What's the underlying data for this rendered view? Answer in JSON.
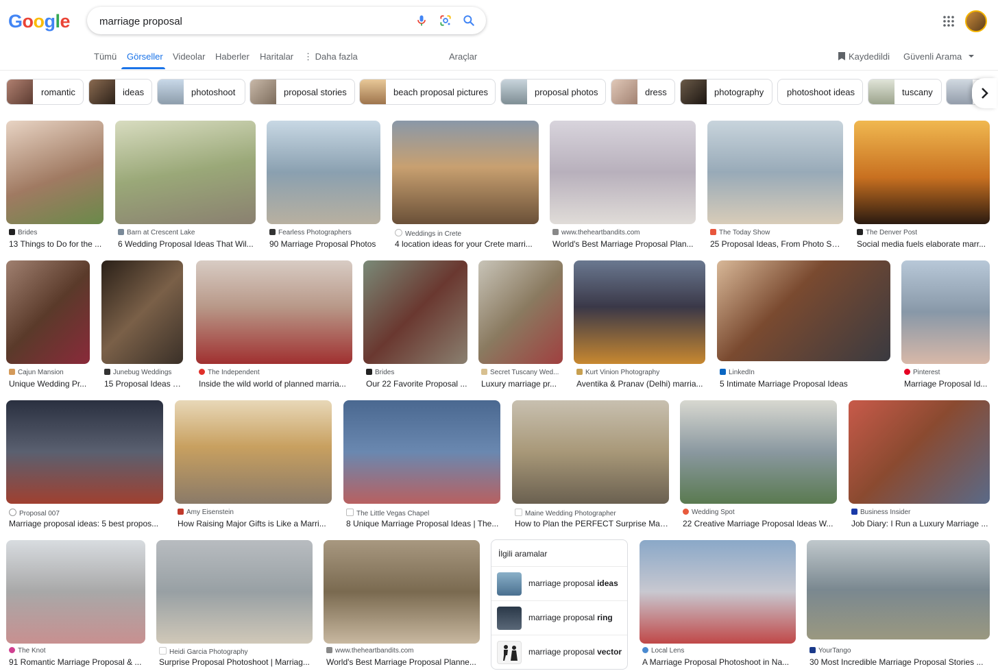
{
  "logo": [
    "G",
    "o",
    "o",
    "g",
    "l",
    "e"
  ],
  "logo_colors": [
    "#4285F4",
    "#EA4335",
    "#FBBC05",
    "#4285F4",
    "#34A853",
    "#EA4335"
  ],
  "search": {
    "value": "marriage proposal"
  },
  "icons": {
    "mic": "microphone-icon",
    "lens": "google-lens-icon",
    "search": "search-icon",
    "apps": "apps-grid-icon",
    "saved": "bookmark-icon",
    "next": "chevron-right-icon"
  },
  "tabs": [
    {
      "label": "Tümü",
      "active": false
    },
    {
      "label": "Görseller",
      "active": true
    },
    {
      "label": "Videolar",
      "active": false
    },
    {
      "label": "Haberler",
      "active": false
    },
    {
      "label": "Haritalar",
      "active": false
    },
    {
      "label": "Daha fazla",
      "active": false
    }
  ],
  "tools_label": "Araçlar",
  "saved_label": "Kaydedildi",
  "safesearch_label": "Güvenli Arama",
  "chips": [
    {
      "label": "romantic",
      "color": "#8a5a48"
    },
    {
      "label": "ideas",
      "color": "#4a3a30"
    },
    {
      "label": "photoshoot",
      "color": "#9bb2c8"
    },
    {
      "label": "proposal stories",
      "color": "#a89888"
    },
    {
      "label": "beach proposal pictures",
      "color": "#c9a070"
    },
    {
      "label": "proposal photos",
      "color": "#9fb0b8"
    },
    {
      "label": "dress",
      "color": "#c8a898"
    },
    {
      "label": "photography",
      "color": "#3a3028"
    },
    {
      "label": "photoshoot ideas",
      "color": ""
    },
    {
      "label": "tuscany",
      "color": "#b8c0a8"
    },
    {
      "label": "",
      "color": "#b0b8c8"
    }
  ],
  "results": [
    {
      "source": "Brides",
      "title": "13 Things to Do for the ...",
      "color": "#c9a896",
      "fav": "#222222"
    },
    {
      "source": "Barn at Crescent Lake",
      "title": "6 Wedding Proposal Ideas That Wil...",
      "color": "#a9b38f",
      "fav": "#7a8a99"
    },
    {
      "source": "Fearless Photographers",
      "title": "90 Marriage Proposal Photos",
      "color": "#8fa8b8",
      "fav": "#333333"
    },
    {
      "source": "Weddings in Crete",
      "title": "4 location ideas for your Crete marri...",
      "color": "#8a7a6a",
      "fav": "#cccccc"
    },
    {
      "source": "www.theheartbandits.com",
      "title": "World's Best Marriage Proposal Plan...",
      "color": "#c8c4cc",
      "fav": "#888888"
    },
    {
      "source": "The Today Show",
      "title": "25 Proposal Ideas, From Photo Sh...",
      "color": "#b8c8d4",
      "fav": "#e8563c"
    },
    {
      "source": "The Denver Post",
      "title": "Social media fuels elaborate marr...",
      "color": "#c88838",
      "fav": "#222222"
    },
    {
      "source": "Cajun Mansion",
      "title": "Unique Wedding Pr...",
      "color": "#6a5040",
      "fav": "#d49a5a"
    },
    {
      "source": "Junebug Weddings",
      "title": "15 Proposal Ideas T...",
      "color": "#3a3028",
      "fav": "#333333"
    },
    {
      "source": "The Independent",
      "title": "Inside the wild world of planned marria...",
      "color": "#b89888",
      "fav": "#e0302a"
    },
    {
      "source": "Brides",
      "title": "Our 22 Favorite Proposal ...",
      "color": "#8a8070",
      "fav": "#222222"
    },
    {
      "source": "Secret Tuscany Wed...",
      "title": "Luxury marriage pr...",
      "color": "#9a9080",
      "fav": "#d8c090"
    },
    {
      "source": "Kurt Vinion Photography",
      "title": "Aventika & Pranav (Delhi) marria...",
      "color": "#4a4a5a",
      "fav": "#c8a050"
    },
    {
      "source": "LinkedIn",
      "title": "5 Intimate Marriage Proposal Ideas",
      "color": "#c8a888",
      "fav": "#0a66c2"
    },
    {
      "source": "Pinterest",
      "title": "Marriage Proposal Id...",
      "color": "#a8b8c8",
      "fav": "#e60023"
    },
    {
      "source": "Proposal 007",
      "title": "Marriage proposal ideas: 5 best propos...",
      "color": "#3a3a48",
      "fav": "#999999"
    },
    {
      "source": "Amy Eisenstein",
      "title": "How Raising Major Gifts is Like a Marri...",
      "color": "#b89868",
      "fav": "#c0392b"
    },
    {
      "source": "The Little Vegas Chapel",
      "title": "8 Unique Marriage Proposal Ideas | The...",
      "color": "#5878a0",
      "fav": "#cccccc"
    },
    {
      "source": "Maine Wedding Photographer",
      "title": "How to Plan the PERFECT Surprise Mar...",
      "color": "#a89878",
      "fav": "#dddddd"
    },
    {
      "source": "Wedding Spot",
      "title": "22 Creative Marriage Proposal Ideas W...",
      "color": "#9aa8b0",
      "fav": "#e85a3c"
    },
    {
      "source": "Business Insider",
      "title": "Job Diary: I Run a Luxury Marriage ...",
      "color": "#a8684a",
      "fav": "#1a3aa8"
    },
    {
      "source": "The Knot",
      "title": "91 Romantic Marriage Proposal & ...",
      "color": "#b8b0a8",
      "fav": "#d04090"
    },
    {
      "source": "Heidi Garcia Photography",
      "title": "Surprise Proposal Photoshoot | Marriag...",
      "color": "#a8a8a4",
      "fav": "#cccccc"
    },
    {
      "source": "www.theheartbandits.com",
      "title": "World's Best Marriage Proposal Planne...",
      "color": "#8a7a60",
      "fav": "#888888"
    },
    {
      "source": "Local Lens",
      "title": "A Marriage Proposal Photoshoot in Na...",
      "color": "#7898b8",
      "fav": "#4a8ad0"
    },
    {
      "source": "YourTango",
      "title": "30 Most Incredible Marriage Proposal Stories ...",
      "color": "#8a9088",
      "fav": "#1a3a8a"
    }
  ],
  "related": {
    "heading": "İlgili aramalar",
    "items": [
      {
        "prefix": "marriage proposal ",
        "bold": "ideas",
        "color": "#8ab0c8"
      },
      {
        "prefix": "marriage proposal ",
        "bold": "ring",
        "color": "#3a4858"
      },
      {
        "prefix": "marriage proposal ",
        "bold": "vector",
        "color": "#eeeeee"
      }
    ]
  }
}
